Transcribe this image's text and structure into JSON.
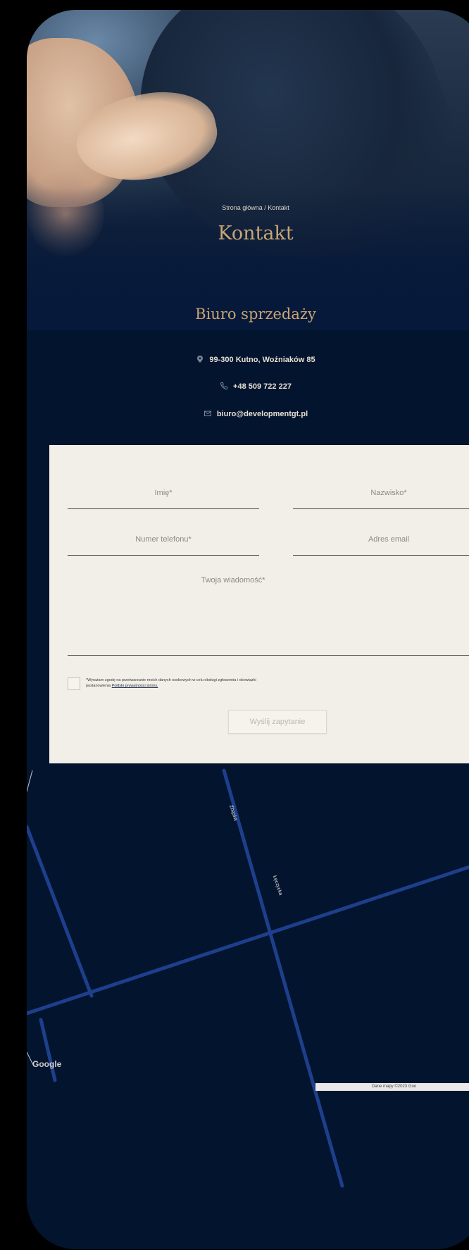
{
  "hero": {
    "breadcrumb": "Strona główna / Kontakt",
    "title": "Kontakt"
  },
  "contact": {
    "title": "Biuro sprzedaży",
    "address": "99-300 Kutno, Woźniaków 85",
    "phone": "+48 509 722 227",
    "email": "biuro@developmentgt.pl"
  },
  "form": {
    "name_placeholder": "Imię*",
    "surname_placeholder": "Nazwisko*",
    "phone_placeholder": "Numer telefonu*",
    "email_placeholder": "Adres email",
    "message_placeholder": "Twoja wiadomość*",
    "consent_line1": "*Wyrażam zgodę na przetwarzanie moich danych osobowych w celu obsługi zgłoszenia i obowiązki",
    "consent_line2_prefix": "postanowienia ",
    "consent_link": "Polityki prywatności strony.",
    "submit_label": "Wyślij zapytanie"
  },
  "map": {
    "street_labels": [
      "Zbąska",
      "Łęczycka"
    ],
    "logo": "Google",
    "footer": "Dane mapy ©2023 Goo"
  },
  "colors": {
    "navy": "#03142e",
    "gold": "#c9a673",
    "road": "#1d3f8c",
    "form_bg": "#f2efe8"
  }
}
